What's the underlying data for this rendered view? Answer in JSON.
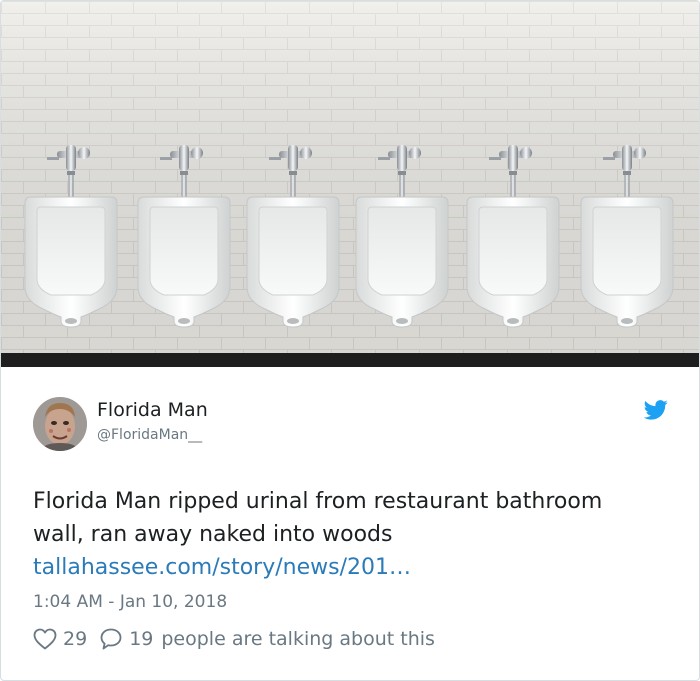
{
  "tweet": {
    "author_name": "Florida Man",
    "author_handle": "@FloridaMan__",
    "text_line_1": "Florida Man ripped urinal from restaurant bathroom",
    "text_line_2": "wall, ran away naked into woods",
    "link_text": "tallahassee.com/story/news/201…",
    "timestamp": "1:04 AM - Jan 10, 2018",
    "likes_count": "29",
    "replies_count": "19",
    "talking_text": "people are talking about this"
  },
  "colors": {
    "link": "#2b7bb9",
    "twitter_blue": "#1da1f2",
    "muted_text": "#697882",
    "body_text": "#1c2022"
  },
  "icons": {
    "brand": "twitter-bird-icon",
    "like": "heart-outline-icon",
    "reply": "speech-bubble-icon"
  },
  "image": {
    "subject": "six-urinals-on-white-tile-wall"
  }
}
